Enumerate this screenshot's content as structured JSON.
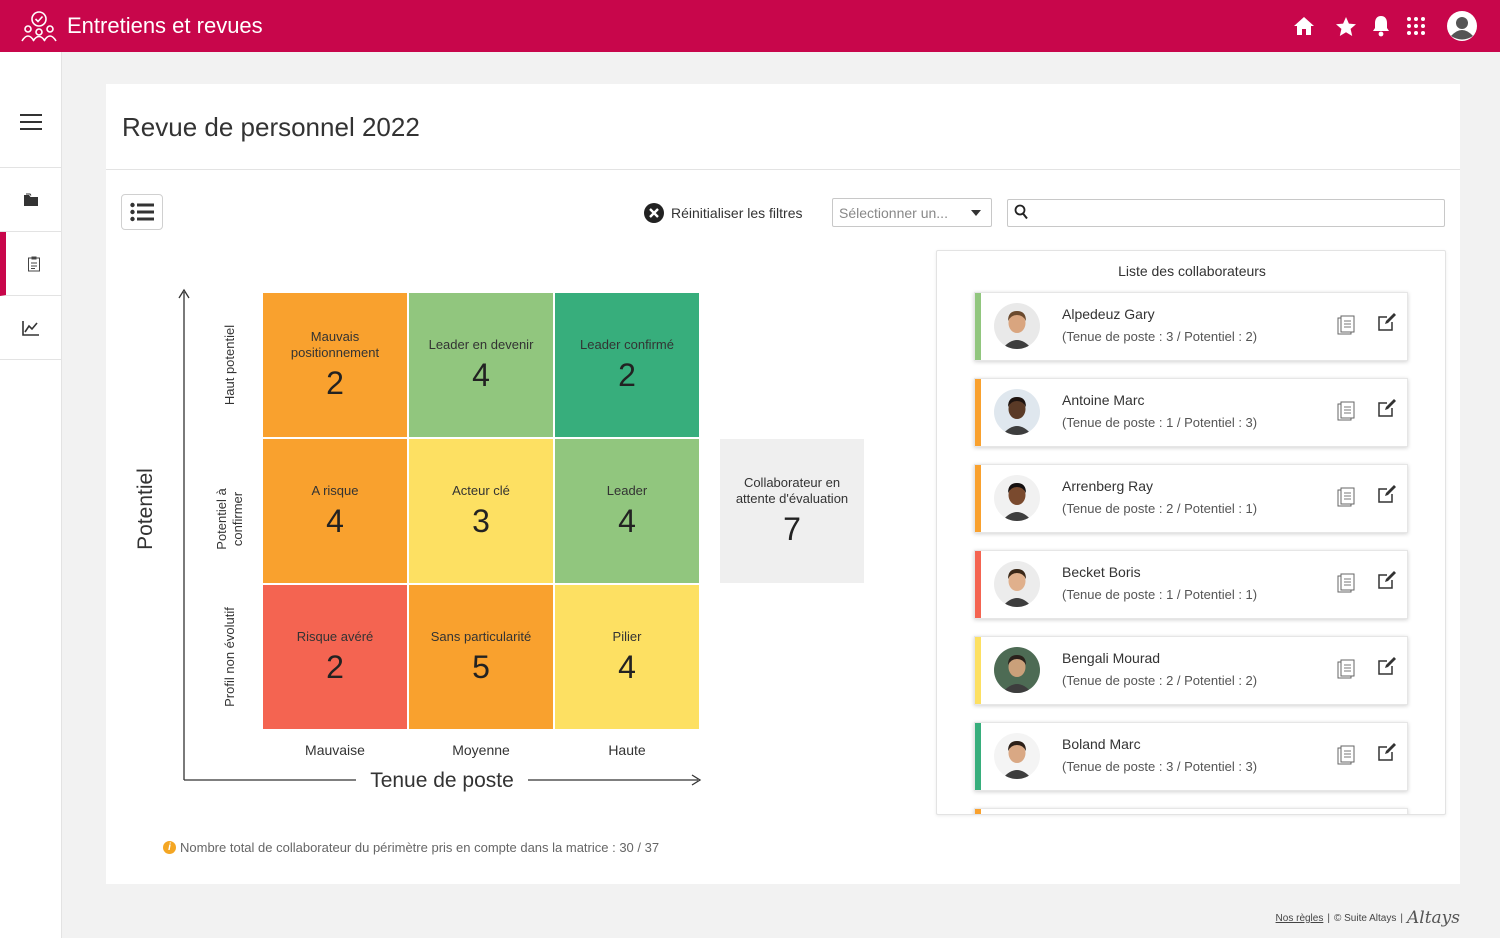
{
  "app": {
    "title": "Entretiens et revues"
  },
  "topbar": {
    "icons": [
      "home-icon",
      "star-icon",
      "bell-icon",
      "apps-grid-icon",
      "user-avatar-icon"
    ]
  },
  "sidebar": {
    "items": [
      "menu-icon",
      "folder-icon",
      "clipboard-icon",
      "chart-line-icon"
    ],
    "active": "clipboard-icon"
  },
  "page": {
    "title": "Revue de personnel 2022"
  },
  "toolbar": {
    "reset_filters": "Réinitialiser les filtres",
    "select_placeholder": "Sélectionner un...",
    "search_value": ""
  },
  "matrix": {
    "y_title": "Potentiel",
    "x_title": "Tenue de poste",
    "y_levels": [
      "Haut potentiel",
      "Potentiel à confirmer",
      "Profil non évolutif"
    ],
    "x_levels": [
      "Mauvaise",
      "Moyenne",
      "Haute"
    ],
    "cells": [
      {
        "label": "Mauvais positionnement",
        "count": "2",
        "color": "#f9a12e"
      },
      {
        "label": "Leader en devenir",
        "count": "4",
        "color": "#91c67e"
      },
      {
        "label": "Leader confirmé",
        "count": "2",
        "color": "#37ae7c"
      },
      {
        "label": "A risque",
        "count": "4",
        "color": "#f9a12e"
      },
      {
        "label": "Acteur clé",
        "count": "3",
        "color": "#fde062"
      },
      {
        "label": "Leader",
        "count": "4",
        "color": "#91c67e"
      },
      {
        "label": "Risque avéré",
        "count": "2",
        "color": "#f46451"
      },
      {
        "label": "Sans particularité",
        "count": "5",
        "color": "#f9a12e"
      },
      {
        "label": "Pilier",
        "count": "4",
        "color": "#fde062"
      }
    ],
    "pending": {
      "label": "Collaborateur en attente d'évaluation",
      "count": "7"
    },
    "total_note": "Nombre total de collaborateur du périmètre pris en compte dans la matrice : 30 / 37"
  },
  "collaborators": {
    "title": "Liste des collaborateurs",
    "items": [
      {
        "name": "Alpedeuz Gary",
        "detail": "(Tenue de poste : 3 / Potentiel : 2)",
        "color": "#91c67e",
        "skin": "#d9a57f",
        "hair": "#6b4a2e",
        "bg": "#e9e9e9"
      },
      {
        "name": "Antoine Marc",
        "detail": "(Tenue de poste : 1 / Potentiel : 3)",
        "color": "#f9a12e",
        "skin": "#5a3a26",
        "hair": "#1e1410",
        "bg": "#dfe7ee"
      },
      {
        "name": "Arrenberg Ray",
        "detail": "(Tenue de poste : 2 / Potentiel : 1)",
        "color": "#f9a12e",
        "skin": "#7a4a2e",
        "hair": "#151010",
        "bg": "#f1f1f1"
      },
      {
        "name": "Becket Boris",
        "detail": "(Tenue de poste : 1 / Potentiel : 1)",
        "color": "#f46451",
        "skin": "#e0b08c",
        "hair": "#3a2818",
        "bg": "#ececec"
      },
      {
        "name": "Bengali Mourad",
        "detail": "(Tenue de poste : 2 / Potentiel : 2)",
        "color": "#fde062",
        "skin": "#caa07a",
        "hair": "#2a211b",
        "bg": "#4d6b54"
      },
      {
        "name": "Boland Marc",
        "detail": "(Tenue de poste : 3 / Potentiel : 3)",
        "color": "#37ae7c",
        "skin": "#d9a884",
        "hair": "#2c2018",
        "bg": "#f4f4f4"
      },
      {
        "name": "",
        "detail": "",
        "color": "#f9a12e",
        "skin": "#d9a884",
        "hair": "#2c2018",
        "bg": "#f4f4f4"
      }
    ]
  },
  "footer": {
    "rules_link": "Nos règles",
    "copyright": "© Suite Altays",
    "logo_text": "Altays"
  }
}
